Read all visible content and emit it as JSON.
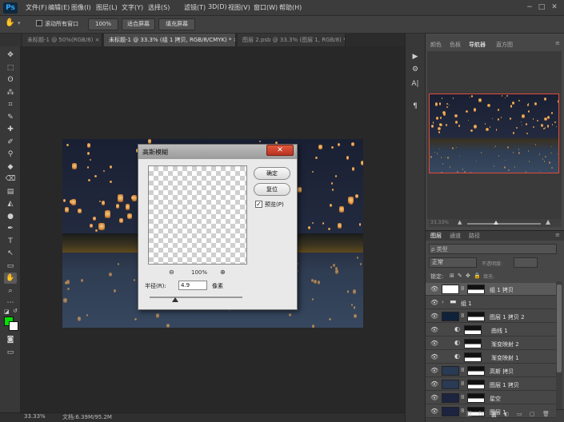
{
  "app": {
    "logo": "Ps"
  },
  "menu": [
    "文件(F)",
    "编辑(E)",
    "图像(I)",
    "图层(L)",
    "文字(Y)",
    "选择(S)",
    "滤镜(T)",
    "3D(D)",
    "视图(V)",
    "窗口(W)",
    "帮助(H)"
  ],
  "window_controls": {
    "minimize": "−",
    "maximize": "□",
    "close": "✕"
  },
  "options_bar": {
    "scroll_all_label": "滚动所有窗口",
    "zoom_btn": "100%",
    "fit_screen_btn": "适合屏幕",
    "fill_screen_btn": "填充屏幕"
  },
  "tabs": [
    {
      "label": "未标题-1 @ 50%(RGB/8) ×",
      "active": false
    },
    {
      "label": "未标题-1 @ 33.3% (组 1 拷贝, RGB/8/CMYK) * ×",
      "active": true
    },
    {
      "label": "图层 2.psb @ 33.3% (图层 1, RGB/8) * ×",
      "active": false
    }
  ],
  "tools": [
    "✥",
    "⬚",
    "ʘ",
    "⁂",
    "⌗",
    "✎",
    "✚",
    "✐",
    "⚲",
    "◆",
    "⌫",
    "▤",
    "◭",
    "●",
    "✒",
    "T",
    "↖",
    "▭",
    "✋",
    "⌕",
    "⋯"
  ],
  "colors": {
    "foreground": "#00e000",
    "background": "#ffffff",
    "accent_close": "#d04a33"
  },
  "status": {
    "zoom": "33.33%",
    "doc": "文档:6.39M/95.2M"
  },
  "dialog": {
    "title": "高斯模糊",
    "close": "✕",
    "ok": "确定",
    "reset": "复位",
    "preview_label": "预览(P)",
    "preview_checked": "✓",
    "zoom_out": "⊖",
    "zoom_in": "⊕",
    "zoom_value": "100%",
    "radius_label": "半径(R):",
    "radius_value": "4.9",
    "radius_unit": "像素",
    "radius_slider_fraction": 0.25
  },
  "panel_tabs": [
    {
      "label": "颜色",
      "active": false
    },
    {
      "label": "色板",
      "active": false
    },
    {
      "label": "导航器",
      "active": true
    },
    {
      "label": "直方图",
      "active": false
    }
  ],
  "navigator": {
    "zoom": "33.33%"
  },
  "layer_tabs": [
    {
      "label": "图层",
      "active": true
    },
    {
      "label": "通道",
      "active": false
    },
    {
      "label": "路径",
      "active": false
    }
  ],
  "layers_panel": {
    "filter": "ρ 类型",
    "blend_mode": "正常",
    "opacity_label": "不透明度:",
    "lock_label": "锁定:",
    "fill_label": "填充:",
    "lock_icons": [
      "⊞",
      "✎",
      "✥",
      "🔒"
    ]
  },
  "layers": [
    {
      "name": "组 1 拷贝",
      "selected": true,
      "thumb": "#ffffff"
    },
    {
      "name": "组 1",
      "selected": false,
      "thumb": "folder"
    },
    {
      "name": "图层 1 拷贝 2",
      "selected": false,
      "thumb": "#10213a"
    },
    {
      "name": "曲线 1",
      "selected": false,
      "thumb": "adj"
    },
    {
      "name": "渐变映射 2",
      "selected": false,
      "thumb": "adj"
    },
    {
      "name": "渐变映射 1",
      "selected": false,
      "thumb": "adj"
    },
    {
      "name": "高斯 拷贝",
      "selected": false,
      "thumb": "#2a3a55"
    },
    {
      "name": "图层 1 拷贝",
      "selected": false,
      "thumb": "#2a3a55"
    },
    {
      "name": "星空",
      "selected": false,
      "thumb": "#1c2440"
    },
    {
      "name": "图层 1",
      "selected": false,
      "thumb": "#1c2440"
    }
  ],
  "layers_footer": [
    "⛓",
    "fx",
    "◙",
    "◐",
    "▭",
    "▢",
    "🗑"
  ],
  "strip_icons": [
    "▶",
    "⚙",
    "A|",
    "¶"
  ]
}
